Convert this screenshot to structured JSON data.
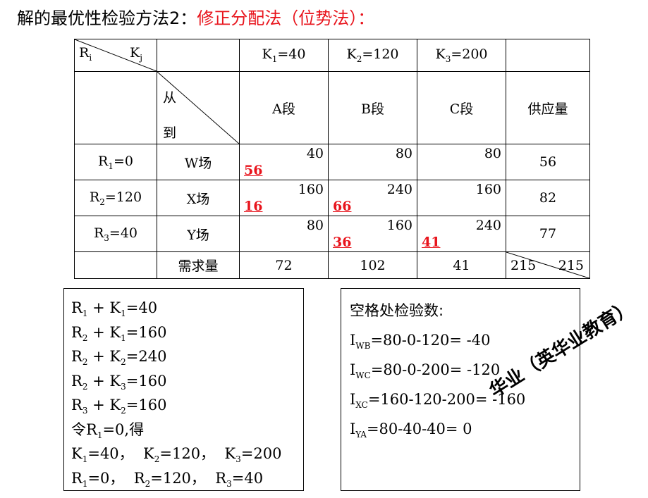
{
  "title": {
    "prefix": "解的最优性检验方法2：",
    "highlight": "修正分配法（位势法）："
  },
  "table": {
    "corner_ri": "R",
    "corner_ri_sub": "i",
    "corner_kj": "K",
    "corner_kj_sub": "j",
    "k_headers": [
      {
        "k": "K",
        "sub": "1",
        "val": "=40"
      },
      {
        "k": "K",
        "sub": "2",
        "val": "=120"
      },
      {
        "k": "K",
        "sub": "3",
        "val": "=200"
      }
    ],
    "from_label": "从",
    "to_label": "到",
    "col_headers": [
      "A段",
      "B段",
      "C段"
    ],
    "supply_header": "供应量",
    "rows": [
      {
        "r": "R",
        "sub": "1",
        "rval": "=0",
        "name": "W场",
        "cells": [
          {
            "cost": "40",
            "alloc": "56"
          },
          {
            "cost": "80",
            "alloc": ""
          },
          {
            "cost": "80",
            "alloc": ""
          }
        ],
        "supply": "56"
      },
      {
        "r": "R",
        "sub": "2",
        "rval": "=120",
        "name": "X场",
        "cells": [
          {
            "cost": "160",
            "alloc": "16"
          },
          {
            "cost": "240",
            "alloc": "66"
          },
          {
            "cost": "160",
            "alloc": ""
          }
        ],
        "supply": "82"
      },
      {
        "r": "R",
        "sub": "3",
        "rval": "=40",
        "name": "Y场",
        "cells": [
          {
            "cost": "80",
            "alloc": ""
          },
          {
            "cost": "160",
            "alloc": "36"
          },
          {
            "cost": "240",
            "alloc": "41"
          }
        ],
        "supply": "77"
      }
    ],
    "demand_label": "需求量",
    "demand": [
      "72",
      "102",
      "41"
    ],
    "total_left": "215",
    "total_right": "215"
  },
  "equations": {
    "lines": [
      {
        "a": "R",
        "as": "1",
        "b": "K",
        "bs": "1",
        "rhs": "=40"
      },
      {
        "a": "R",
        "as": "2",
        "b": "K",
        "bs": "1",
        "rhs": "=160"
      },
      {
        "a": "R",
        "as": "2",
        "b": "K",
        "bs": "2",
        "rhs": "=240"
      },
      {
        "a": "R",
        "as": "2",
        "b": "K",
        "bs": "3",
        "rhs": "=160"
      },
      {
        "a": "R",
        "as": "3",
        "b": "K",
        "bs": "2",
        "rhs": "=160"
      }
    ],
    "let_pre": "令R",
    "let_sub": "1",
    "let_post": "=0,得",
    "k_result": [
      {
        "k": "K",
        "s": "1",
        "v": "=40，"
      },
      {
        "k": "K",
        "s": "2",
        "v": "=120，"
      },
      {
        "k": "K",
        "s": "3",
        "v": "=200"
      }
    ],
    "r_result": [
      {
        "k": "R",
        "s": "1",
        "v": "=0，"
      },
      {
        "k": "R",
        "s": "2",
        "v": "=120，"
      },
      {
        "k": "R",
        "s": "3",
        "v": "=40"
      }
    ]
  },
  "check": {
    "heading": "空格处检验数:",
    "items": [
      {
        "sym": "I",
        "sub": "WB",
        "expr": "=80-0-120= -40"
      },
      {
        "sym": "I",
        "sub": "WC",
        "expr": "=80-0-200= -120"
      },
      {
        "sym": "I",
        "sub": "XC",
        "expr": "=160-120-200= -160"
      },
      {
        "sym": "I",
        "sub": "YA",
        "expr": "=80-40-40= 0"
      }
    ]
  },
  "watermark": "华业（英华业教育）",
  "colors": {
    "highlight": "#e8141c"
  }
}
